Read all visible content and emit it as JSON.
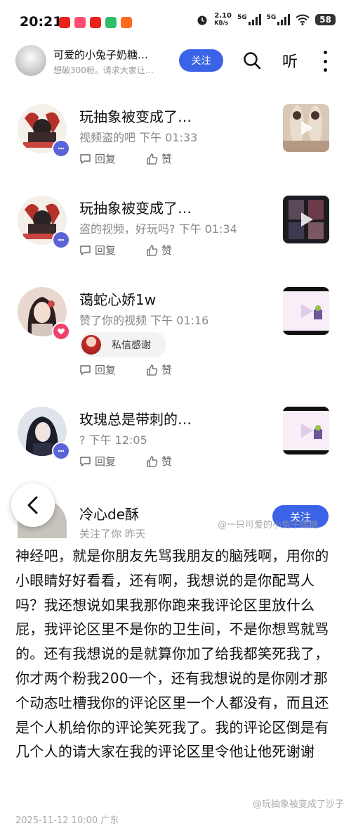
{
  "status_bar": {
    "time": "20:21",
    "net_speed": "2.10",
    "net_unit": "KB/s",
    "sig1": "5G",
    "sig2": "5G",
    "battery": "58"
  },
  "header": {
    "title": "可爱的小兔子奶糖…",
    "subtitle": "想破300粉。请求大家让…",
    "follow_label": "关注",
    "listen_label": "听"
  },
  "rows": [
    {
      "name": "玩抽象被变成了…",
      "meta": "视频盗的吧  下午 01:33",
      "reply": "回复",
      "like": "赞"
    },
    {
      "name": "玩抽象被变成了…",
      "meta": "盗的视频，好玩吗?  下午 01:34",
      "reply": "回复",
      "like": "赞"
    },
    {
      "name": "蔼蛇心娇1w",
      "meta": "赞了你的视频  下午 01:16",
      "chip_label": "私信感谢",
      "reply": "回复",
      "like": "赞"
    },
    {
      "name": "玫瑰总是带刺的…",
      "meta": "?   下午 12:05",
      "reply": "回复",
      "like": "赞"
    }
  ],
  "last_row": {
    "name": "冷心de酥",
    "meta": "关注了你  昨天",
    "follow_label": "关注"
  },
  "watermarks": {
    "mid": "@一只可爱的小兔子绵糖",
    "bottom": "@玩抽象被变成了沙子"
  },
  "caption": {
    "text": "神经吧，就是你朋友先骂我朋友的脑残啊，用你的小眼睛好好看看，还有啊，我想说的是你配骂人吗？我还想说如果我那你跑来我评论区里放什么屁，我评论区里不是你的卫生间，不是你想骂就骂的。还有我想说的是就算你加了给我都笑死我了，你才两个粉我200一个，还有我想说的是你刚才那个动态吐槽我你的评论区里一个人都没有，而且还是个人机给你的评论笑死我了。我的评论区倒是有几个人的请大家在我的评论区里令他让他死谢谢",
    "cutoff_date": "2025-11-12 10:00  广东"
  },
  "colors": {
    "accent": "#3a63e8",
    "comment_badge": "#5b63d8",
    "like_badge": "#f0416a"
  },
  "icons": [
    "back-arrow-icon",
    "search-icon",
    "more-icon",
    "reply-icon",
    "like-icon",
    "play-icon",
    "comment-badge-icon",
    "heart-badge-icon"
  ]
}
